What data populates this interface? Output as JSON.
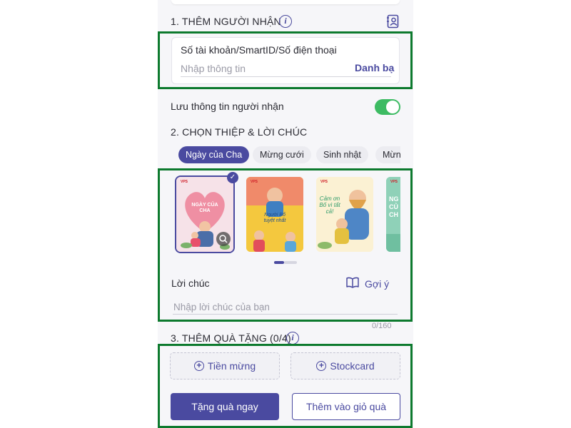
{
  "section1": {
    "title": "1. THÊM NGƯỜI NHẬN",
    "info_icon": "info-icon",
    "contact_icon": "contact-book-icon"
  },
  "recipient": {
    "label": "Số tài khoản/SmartID/Số điện thoại",
    "placeholder": "Nhập thông tin",
    "value": "",
    "contacts_link": "Danh bạ"
  },
  "save_recipient": {
    "label": "Lưu thông tin người nhận",
    "enabled": true
  },
  "section2": {
    "title": "2. CHỌN THIỆP & LỜI CHÚC"
  },
  "categories": [
    {
      "label": "Ngày của Cha",
      "active": true
    },
    {
      "label": "Mừng cưới",
      "active": false
    },
    {
      "label": "Sinh nhật",
      "active": false
    },
    {
      "label": "Mừn",
      "active": false
    }
  ],
  "cards": [
    {
      "brand": "VPS",
      "text": "NGÀY CỦA CHA",
      "selected": true
    },
    {
      "brand": "VPS",
      "text": "Người Bố tuyệt nhất",
      "selected": false
    },
    {
      "brand": "VPS",
      "text": "Cảm ơn Bố vì tất cả!",
      "selected": false
    },
    {
      "brand": "VPS",
      "text": "NG CỦ CH",
      "selected": false
    }
  ],
  "wish": {
    "label": "Lời chúc",
    "suggest_label": "Gợi ý",
    "suggest_icon": "book-open-icon",
    "placeholder": "Nhập lời chúc của bạn",
    "counter": "0/160"
  },
  "section3": {
    "title": "3. THÊM QUÀ TẶNG (0/4)"
  },
  "gifts": {
    "cash_label": "Tiền mừng",
    "stock_label": "Stockcard"
  },
  "actions": {
    "gift_now": "Tặng quà ngay",
    "add_to_basket": "Thêm vào giỏ quà"
  },
  "colors": {
    "primary": "#4a4aa0",
    "toggle_on": "#3dbb63",
    "highlight_frame": "#0d7a2e",
    "background": "#f6f6f9"
  }
}
